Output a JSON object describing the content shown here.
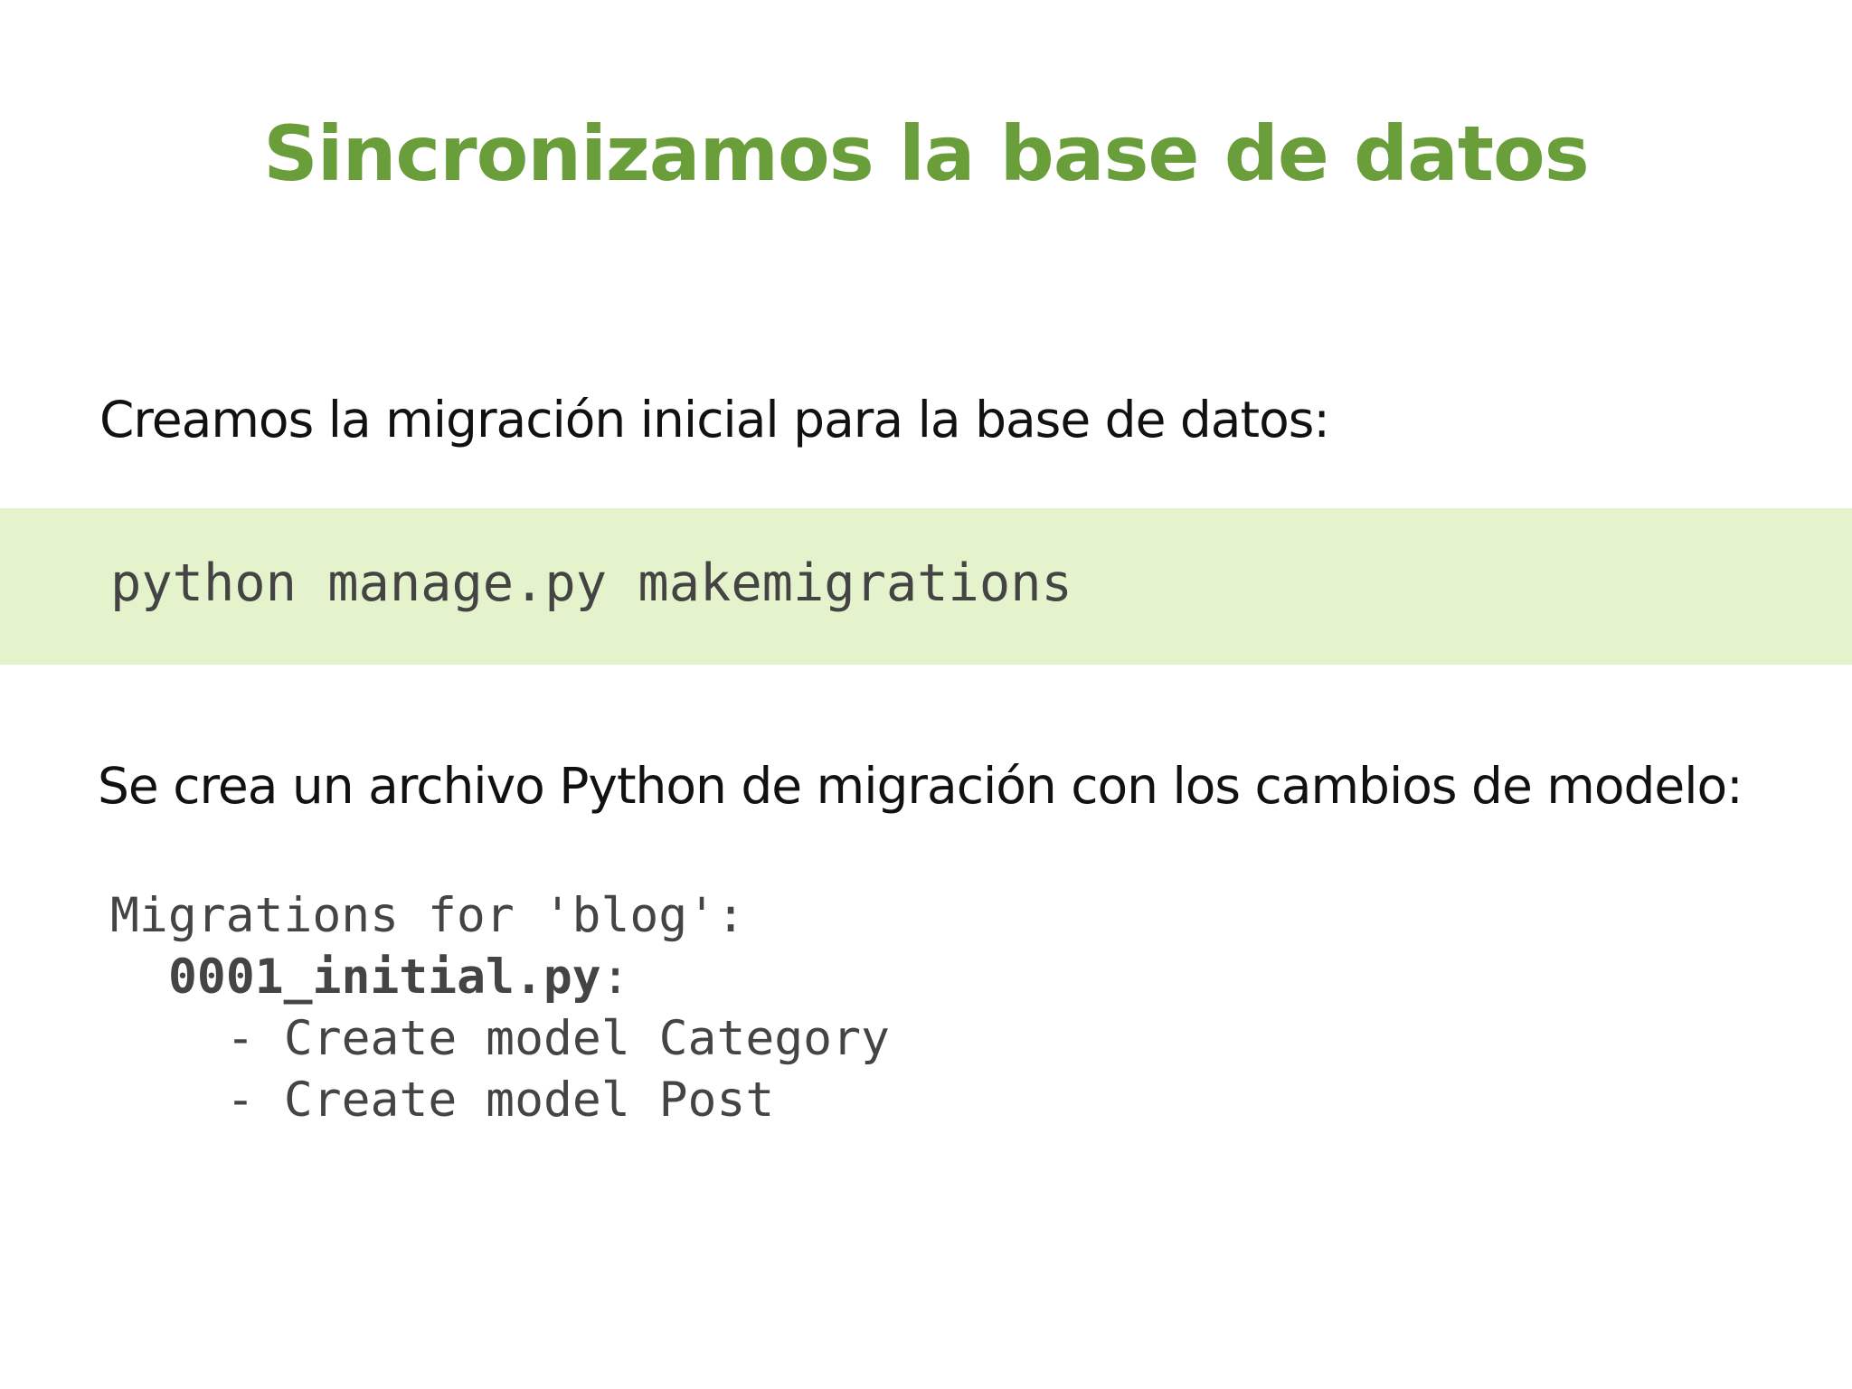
{
  "slide": {
    "title": "Sincronizamos la base de datos",
    "intro_text": "Creamos la migración inicial para la base de datos:",
    "command": "python manage.py makemigrations",
    "result_text": "Se crea un archivo Python de migración con los cambios de modelo:",
    "output": {
      "header": "Migrations for 'blog':",
      "file_name": "0001_initial.py",
      "file_suffix": ":",
      "changes": [
        "- Create model Category",
        "- Create model Post"
      ]
    }
  },
  "colors": {
    "title": "#6a9e3b",
    "body_text": "#111111",
    "code_text": "#444444",
    "command_band": "#e5f3cc",
    "background": "#ffffff"
  }
}
